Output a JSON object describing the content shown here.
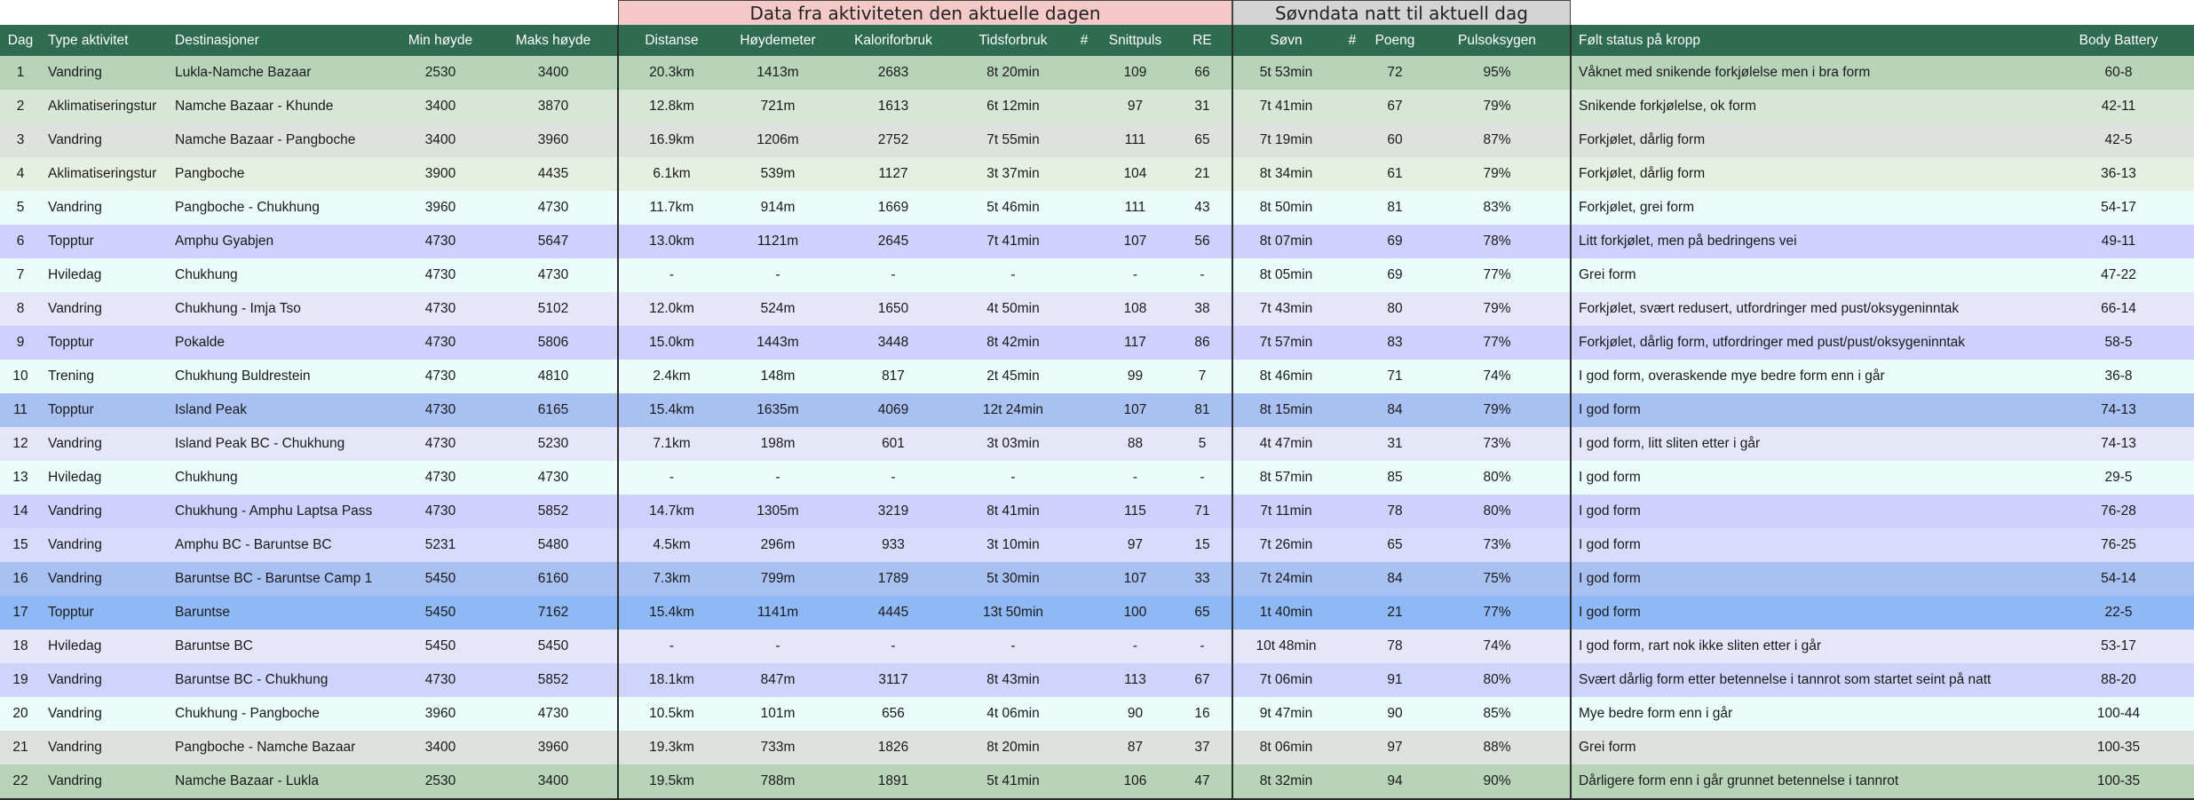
{
  "banners": {
    "activity": "Data fra aktiviteten den aktuelle dagen",
    "sleep": "Søvndata natt til aktuell dag"
  },
  "columns": [
    "Dag",
    "Type aktivitet",
    "Destinasjoner",
    "Min høyde",
    "Maks høyde",
    "Distanse",
    "Høydemeter",
    "Kaloriforbruk",
    "Tidsforbruk",
    "#",
    "Snittpuls",
    "RE",
    "Søvn",
    "#",
    "Poeng",
    "Pulsoksygen",
    "Følt status på kropp",
    "Body Battery"
  ],
  "row_colors": [
    "#b8d4b8",
    "#d8e6d8",
    "#dde2dd",
    "#e6f0e2",
    "#eafdfa",
    "#cfd0fc",
    "#eafdfa",
    "#e6e6fb",
    "#cfd0fc",
    "#eafdfa",
    "#a8c0f2",
    "#e6e6fb",
    "#eafdfa",
    "#cfd0fc",
    "#d8dbfb",
    "#a8c0f2",
    "#8fb8f7",
    "#e6e6fb",
    "#d0d4fb",
    "#eafdfa",
    "#dde2dd",
    "#b8d4b8"
  ],
  "rows": [
    [
      "1",
      "Vandring",
      "Lukla-Namche Bazaar",
      "2530",
      "3400",
      "20.3km",
      "1413m",
      "2683",
      "8t 20min",
      "",
      "109",
      "66",
      "5t 53min",
      "",
      "72",
      "95%",
      "Våknet med snikende forkjølelse men i bra form",
      "60-8"
    ],
    [
      "2",
      "Aklimatiseringstur",
      "Namche Bazaar - Khunde",
      "3400",
      "3870",
      "12.8km",
      "721m",
      "1613",
      "6t 12min",
      "",
      "97",
      "31",
      "7t 41min",
      "",
      "67",
      "79%",
      "Snikende forkjølelse, ok form",
      "42-11"
    ],
    [
      "3",
      "Vandring",
      "Namche Bazaar - Pangboche",
      "3400",
      "3960",
      "16.9km",
      "1206m",
      "2752",
      "7t 55min",
      "",
      "111",
      "65",
      "7t 19min",
      "",
      "60",
      "87%",
      "Forkjølet, dårlig form",
      "42-5"
    ],
    [
      "4",
      "Aklimatiseringstur",
      "Pangboche",
      "3900",
      "4435",
      "6.1km",
      "539m",
      "1127",
      "3t 37min",
      "",
      "104",
      "21",
      "8t 34min",
      "",
      "61",
      "79%",
      "Forkjølet, dårlig form",
      "36-13"
    ],
    [
      "5",
      "Vandring",
      "Pangboche - Chukhung",
      "3960",
      "4730",
      "11.7km",
      "914m",
      "1669",
      "5t 46min",
      "",
      "111",
      "43",
      "8t 50min",
      "",
      "81",
      "83%",
      "Forkjølet, grei form",
      "54-17"
    ],
    [
      "6",
      "Topptur",
      "Amphu Gyabjen",
      "4730",
      "5647",
      "13.0km",
      "1121m",
      "2645",
      "7t 41min",
      "",
      "107",
      "56",
      "8t 07min",
      "",
      "69",
      "78%",
      "Litt forkjølet, men på bedringens vei",
      "49-11"
    ],
    [
      "7",
      "Hviledag",
      "Chukhung",
      "4730",
      "4730",
      "-",
      "-",
      "-",
      "-",
      "",
      "-",
      "-",
      "8t 05min",
      "",
      "69",
      "77%",
      "Grei form",
      "47-22"
    ],
    [
      "8",
      "Vandring",
      "Chukhung - Imja Tso",
      "4730",
      "5102",
      "12.0km",
      "524m",
      "1650",
      "4t 50min",
      "",
      "108",
      "38",
      "7t 43min",
      "",
      "80",
      "79%",
      "Forkjølet, svært redusert, utfordringer med pust/oksygeninntak",
      "66-14"
    ],
    [
      "9",
      "Topptur",
      "Pokalde",
      "4730",
      "5806",
      "15.0km",
      "1443m",
      "3448",
      "8t 42min",
      "",
      "117",
      "86",
      "7t 57min",
      "",
      "83",
      "77%",
      "Forkjølet, dårlig form, utfordringer med pust/pust/oksygeninntak",
      "58-5"
    ],
    [
      "10",
      "Trening",
      "Chukhung Buldrestein",
      "4730",
      "4810",
      "2.4km",
      "148m",
      "817",
      "2t 45min",
      "",
      "99",
      "7",
      "8t 46min",
      "",
      "71",
      "74%",
      "I god form, overaskende mye bedre form enn i går",
      "36-8"
    ],
    [
      "11",
      "Topptur",
      "Island Peak",
      "4730",
      "6165",
      "15.4km",
      "1635m",
      "4069",
      "12t 24min",
      "",
      "107",
      "81",
      "8t 15min",
      "",
      "84",
      "79%",
      "I god form",
      "74-13"
    ],
    [
      "12",
      "Vandring",
      "Island Peak BC - Chukhung",
      "4730",
      "5230",
      "7.1km",
      "198m",
      "601",
      "3t 03min",
      "",
      "88",
      "5",
      "4t 47min",
      "",
      "31",
      "73%",
      "I god form, litt sliten etter i går",
      "74-13"
    ],
    [
      "13",
      "Hviledag",
      "Chukhung",
      "4730",
      "4730",
      "-",
      "-",
      "-",
      "-",
      "",
      "-",
      "-",
      "8t 57min",
      "",
      "85",
      "80%",
      "I god form",
      "29-5"
    ],
    [
      "14",
      "Vandring",
      "Chukhung - Amphu Laptsa Pass",
      "4730",
      "5852",
      "14.7km",
      "1305m",
      "3219",
      "8t 41min",
      "",
      "115",
      "71",
      "7t 11min",
      "",
      "78",
      "80%",
      "I god form",
      "76-28"
    ],
    [
      "15",
      "Vandring",
      "Amphu BC - Baruntse BC",
      "5231",
      "5480",
      "4.5km",
      "296m",
      "933",
      "3t 10min",
      "",
      "97",
      "15",
      "7t 26min",
      "",
      "65",
      "73%",
      "I god form",
      "76-25"
    ],
    [
      "16",
      "Vandring",
      "Baruntse BC - Baruntse Camp 1",
      "5450",
      "6160",
      "7.3km",
      "799m",
      "1789",
      "5t 30min",
      "",
      "107",
      "33",
      "7t 24min",
      "",
      "84",
      "75%",
      "I god form",
      "54-14"
    ],
    [
      "17",
      "Topptur",
      "Baruntse",
      "5450",
      "7162",
      "15.4km",
      "1141m",
      "4445",
      "13t 50min",
      "",
      "100",
      "65",
      "1t 40min",
      "",
      "21",
      "77%",
      "I god form",
      "22-5"
    ],
    [
      "18",
      "Hviledag",
      "Baruntse BC",
      "5450",
      "5450",
      "-",
      "-",
      "-",
      "-",
      "",
      "-",
      "-",
      "10t 48min",
      "",
      "78",
      "74%",
      "I god form, rart nok ikke sliten etter i går",
      "53-17"
    ],
    [
      "19",
      "Vandring",
      "Baruntse BC - Chukhung",
      "4730",
      "5852",
      "18.1km",
      "847m",
      "3117",
      "8t 43min",
      "",
      "113",
      "67",
      "7t 06min",
      "",
      "91",
      "80%",
      "Svært dårlig form etter betennelse i tannrot som startet seint på natt",
      "88-20"
    ],
    [
      "20",
      "Vandring",
      "Chukhung - Pangboche",
      "3960",
      "4730",
      "10.5km",
      "101m",
      "656",
      "4t 06min",
      "",
      "90",
      "16",
      "9t 47min",
      "",
      "90",
      "85%",
      "Mye bedre form enn i går",
      "100-44"
    ],
    [
      "21",
      "Vandring",
      "Pangboche - Namche Bazaar",
      "3400",
      "3960",
      "19.3km",
      "733m",
      "1826",
      "8t 20min",
      "",
      "87",
      "37",
      "8t 06min",
      "",
      "97",
      "88%",
      "Grei form",
      "100-35"
    ],
    [
      "22",
      "Vandring",
      "Namche Bazaar - Lukla",
      "2530",
      "3400",
      "19.5km",
      "788m",
      "1891",
      "5t 41min",
      "",
      "106",
      "47",
      "8t 32min",
      "",
      "94",
      "90%",
      "Dårligere form enn i går grunnet betennelse i tannrot",
      "100-35"
    ]
  ]
}
